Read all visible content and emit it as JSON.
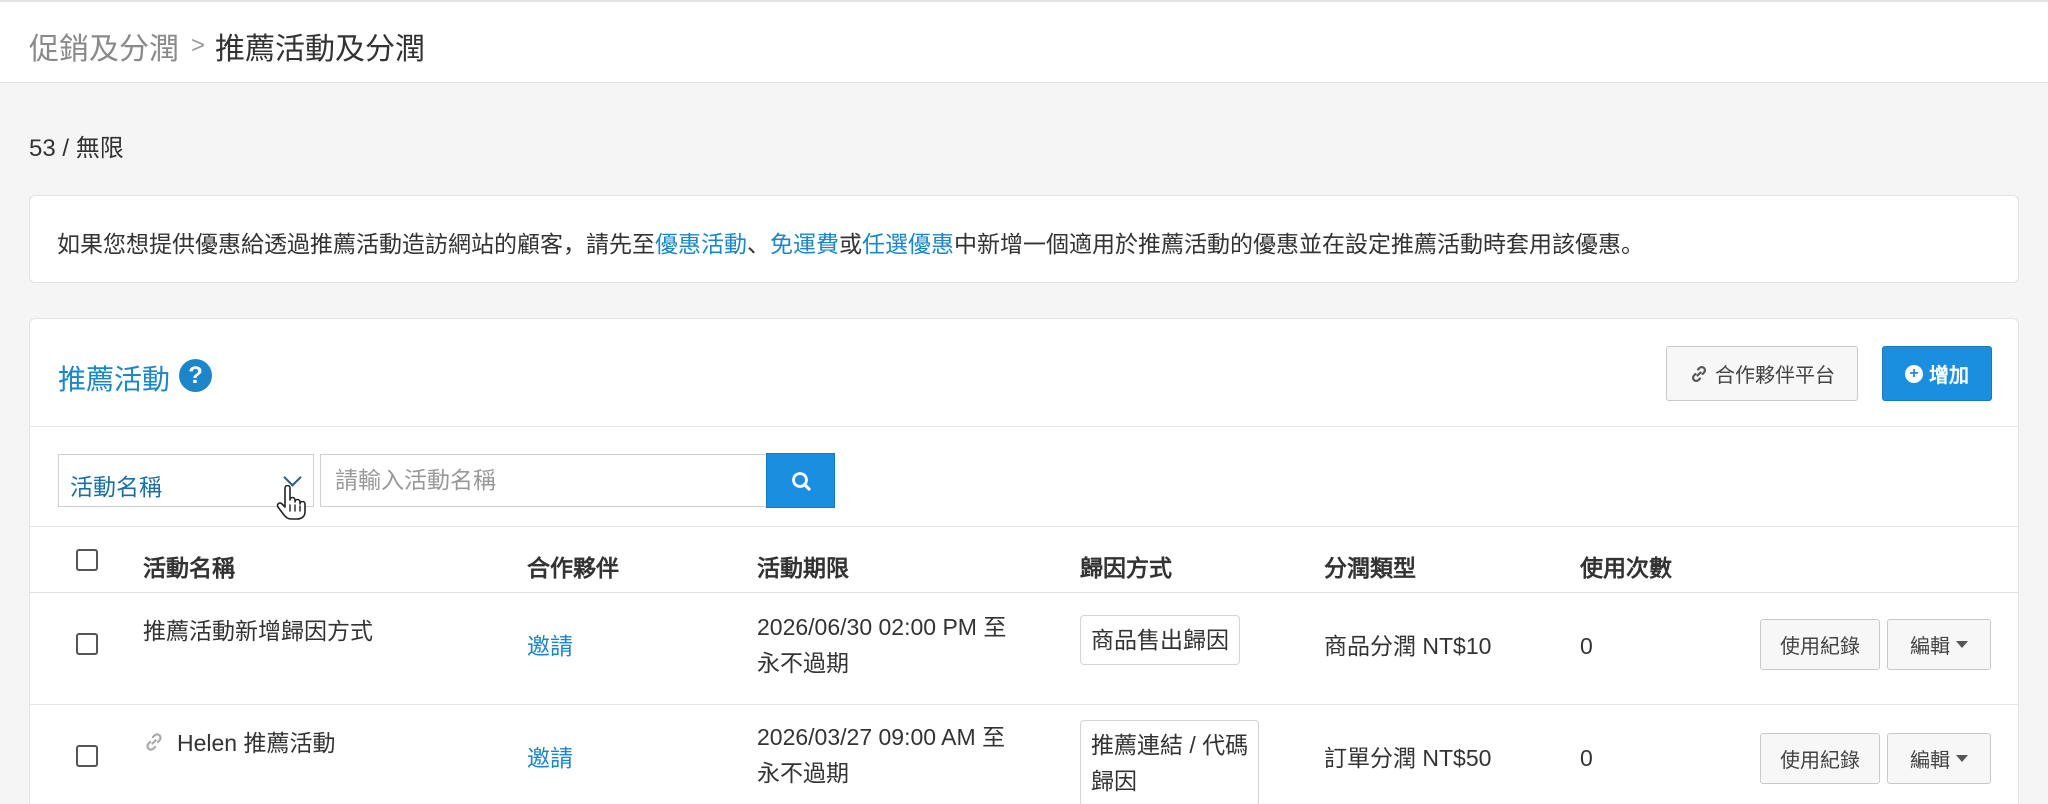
{
  "breadcrumb": {
    "parent": "促銷及分潤",
    "separator": ">",
    "current": "推薦活動及分潤"
  },
  "quota": "53 / 無限",
  "notice": {
    "before": "如果您想提供優惠給透過推薦活動造訪網站的顧客，請先至",
    "link1": "優惠活動",
    "sep1": "、",
    "link2": "免運費",
    "sep2": "或",
    "link3": "任選優惠",
    "after": "中新增一個適用於推薦活動的優惠並在設定推薦活動時套用該優惠。"
  },
  "panel": {
    "title": "推薦活動",
    "help_icon": "?",
    "partner_button": "合作夥伴平台",
    "add_button": "增加"
  },
  "filter": {
    "select_value": "活動名稱",
    "search_placeholder": "請輸入活動名稱"
  },
  "table": {
    "headers": [
      "活動名稱",
      "合作夥伴",
      "活動期限",
      "歸因方式",
      "分潤類型",
      "使用次數"
    ],
    "rows": [
      {
        "name": "推薦活動新增歸因方式",
        "partner": "邀請",
        "period_line1": "2026/06/30 02:00 PM 至",
        "period_line2": "永不過期",
        "attribution_line1": "商品售出歸因",
        "attribution_line2": "",
        "commission": "商品分潤 NT$10",
        "uses": "0",
        "log_button": "使用紀錄",
        "edit_button": "編輯"
      },
      {
        "name": "Helen 推薦活動",
        "partner": "邀請",
        "period_line1": "2026/03/27 09:00 AM 至",
        "period_line2": "永不過期",
        "attribution_line1": "推薦連結 / 代碼",
        "attribution_line2": "歸因",
        "commission": "訂單分潤 NT$50",
        "uses": "0",
        "log_button": "使用紀錄",
        "edit_button": "編輯"
      }
    ]
  },
  "colors": {
    "accent": "#1c86c8",
    "primary_button": "#1a8fe0",
    "background": "#f5f5f5"
  }
}
